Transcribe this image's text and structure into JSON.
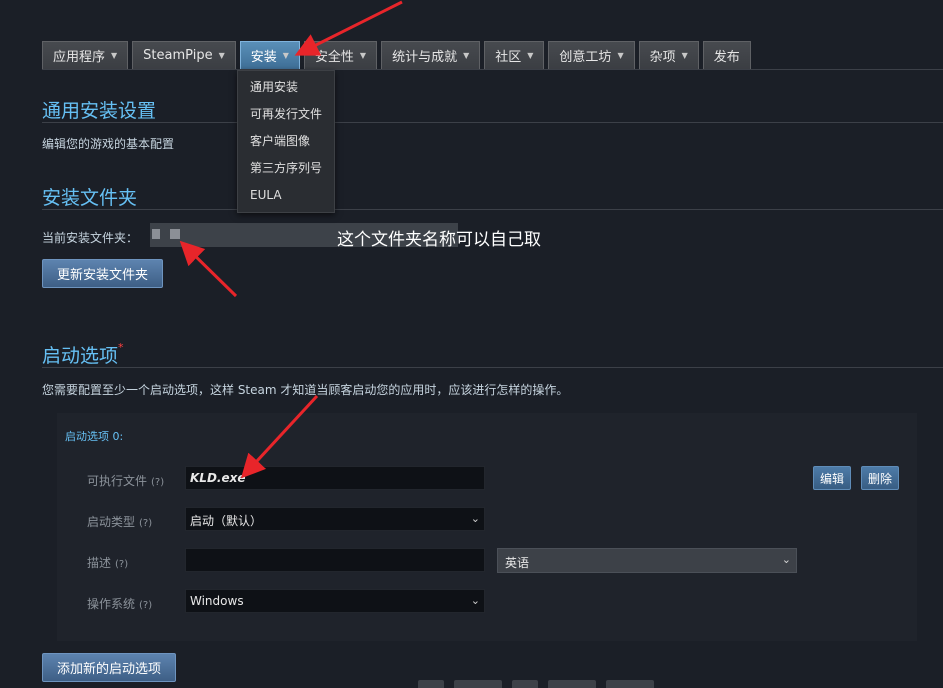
{
  "tabs": [
    {
      "label": "应用程序",
      "caret": "▼"
    },
    {
      "label": "SteamPipe",
      "caret": "▼"
    },
    {
      "label": "安装",
      "caret": "▼"
    },
    {
      "label": "安全性",
      "caret": "▼"
    },
    {
      "label": "统计与成就",
      "caret": "▼"
    },
    {
      "label": "社区",
      "caret": "▼"
    },
    {
      "label": "创意工坊",
      "caret": "▼"
    },
    {
      "label": "杂项",
      "caret": "▼"
    },
    {
      "label": "发布",
      "caret": ""
    }
  ],
  "install_menu": [
    "通用安装",
    "可再发行文件",
    "客户端图像",
    "第三方序列号",
    "EULA"
  ],
  "general": {
    "title": "通用安装设置",
    "description": "编辑您的游戏的基本配置"
  },
  "folder": {
    "title": "安装文件夹",
    "current_label": "当前安装文件夹：",
    "annotation": "这个文件夹名称可以自己取",
    "update_button": "更新安装文件夹"
  },
  "launch": {
    "title": "启动选项",
    "required_mark": "*",
    "description": "您需要配置至少一个启动选项，这样 Steam 才知道当顾客启动您的应用时，应该进行怎样的操作。",
    "option_title": "启动选项 0:",
    "help_mark": "(?)",
    "executable_label": "可执行文件",
    "executable_value": "KLD.exe",
    "type_label": "启动类型",
    "type_value": "启动（默认）",
    "desc_label": "描述",
    "desc_value": "",
    "language_value": "英语",
    "os_label": "操作系统",
    "os_value": "Windows",
    "edit_button": "编辑",
    "delete_button": "删除",
    "add_button": "添加新的启动选项"
  },
  "colors": {
    "accent": "#66c0f4",
    "annotation_arrow": "#e8252a",
    "background": "#1b1f27"
  },
  "icons": {
    "dropdown_chevron": "chevron-down-icon",
    "arrow": "red-arrow-annotation"
  }
}
